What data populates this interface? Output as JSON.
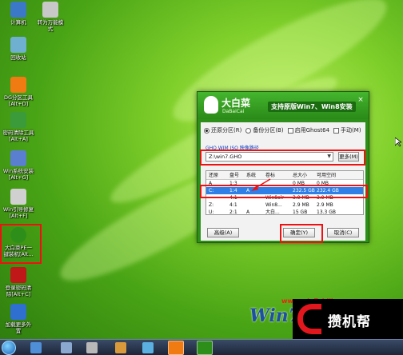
{
  "desktop": {
    "icons": [
      {
        "name": "computer",
        "label": "计算机",
        "color": "#3c78c8"
      },
      {
        "name": "tools",
        "label": "转为万能模\n式",
        "color": "#c8c8c8"
      },
      {
        "name": "recycle",
        "label": "回收站",
        "color": "#6fb0d0"
      },
      {
        "name": "dg",
        "label": "DG分区工具\n[Alt+D]",
        "color": "#f07b12"
      },
      {
        "name": "password",
        "label": "密码清除工具\n[Alt+A]",
        "color": "#3b9b3b"
      },
      {
        "name": "install",
        "label": "Win系统安装\n[Alt+G]",
        "color": "#5a7fd0"
      },
      {
        "name": "boot-repair",
        "label": "Win引导修复\n[Alt+F]",
        "color": "#d0d0d0"
      },
      {
        "name": "dbc",
        "label": "大白菜PE一\n键装机[Alt...",
        "color": "#2d8f1a"
      },
      {
        "name": "nt",
        "label": "登录密码清\n除[Alt+C]",
        "color": "#c01818"
      },
      {
        "name": "more",
        "label": "加载更多外\n置",
        "color": "#2f6fd0"
      }
    ]
  },
  "dialog": {
    "brand_title": "大白菜",
    "brand_sub": "DaBaiCai",
    "slogan": "支持原版Win7、Win8安装",
    "close_label": "×",
    "modes": [
      {
        "label": "还原分区(R)",
        "checked": true,
        "type": "radio"
      },
      {
        "label": "备份分区(B)",
        "checked": false,
        "type": "radio"
      },
      {
        "label": "启用Ghost64",
        "checked": false,
        "type": "checkbox"
      },
      {
        "label": "手动(M)",
        "checked": false,
        "type": "checkbox"
      }
    ],
    "path_label": "GHO WIM ISO 映像路径",
    "path_value": "Z:\\win7.GHO",
    "more_label": "更多(M)",
    "columns": [
      "还原",
      "盘号",
      "系统",
      "卷标",
      "总大小",
      "可用空间"
    ],
    "rows": [
      {
        "cells": [
          "A",
          "1:3",
          "",
          "",
          "0 MB",
          "0 MB"
        ],
        "selected": false
      },
      {
        "cells": [
          "C:",
          "1:4",
          "A",
          "",
          "232.5 GB",
          "232.4 GB"
        ],
        "selected": true
      },
      {
        "cells": [
          "",
          "4:1",
          "",
          "Win8olr",
          "3.9 MB",
          "3.9 MB"
        ],
        "selected": false
      },
      {
        "cells": [
          "Z:",
          "4:1",
          "",
          "Win8...",
          "2.9 MB",
          "2.9 MB"
        ],
        "selected": false
      },
      {
        "cells": [
          "U:",
          "2:1",
          "A",
          "大白...",
          "15 GB",
          "13.3 GB"
        ],
        "selected": false
      }
    ],
    "advanced_label": "高级(A)",
    "ok_label": "确定(Y)",
    "cancel_label": "取消(C)"
  },
  "watermark": {
    "text": "Win7",
    "url": "www.win7zhijia.cn",
    "brand": "攒机帮"
  }
}
